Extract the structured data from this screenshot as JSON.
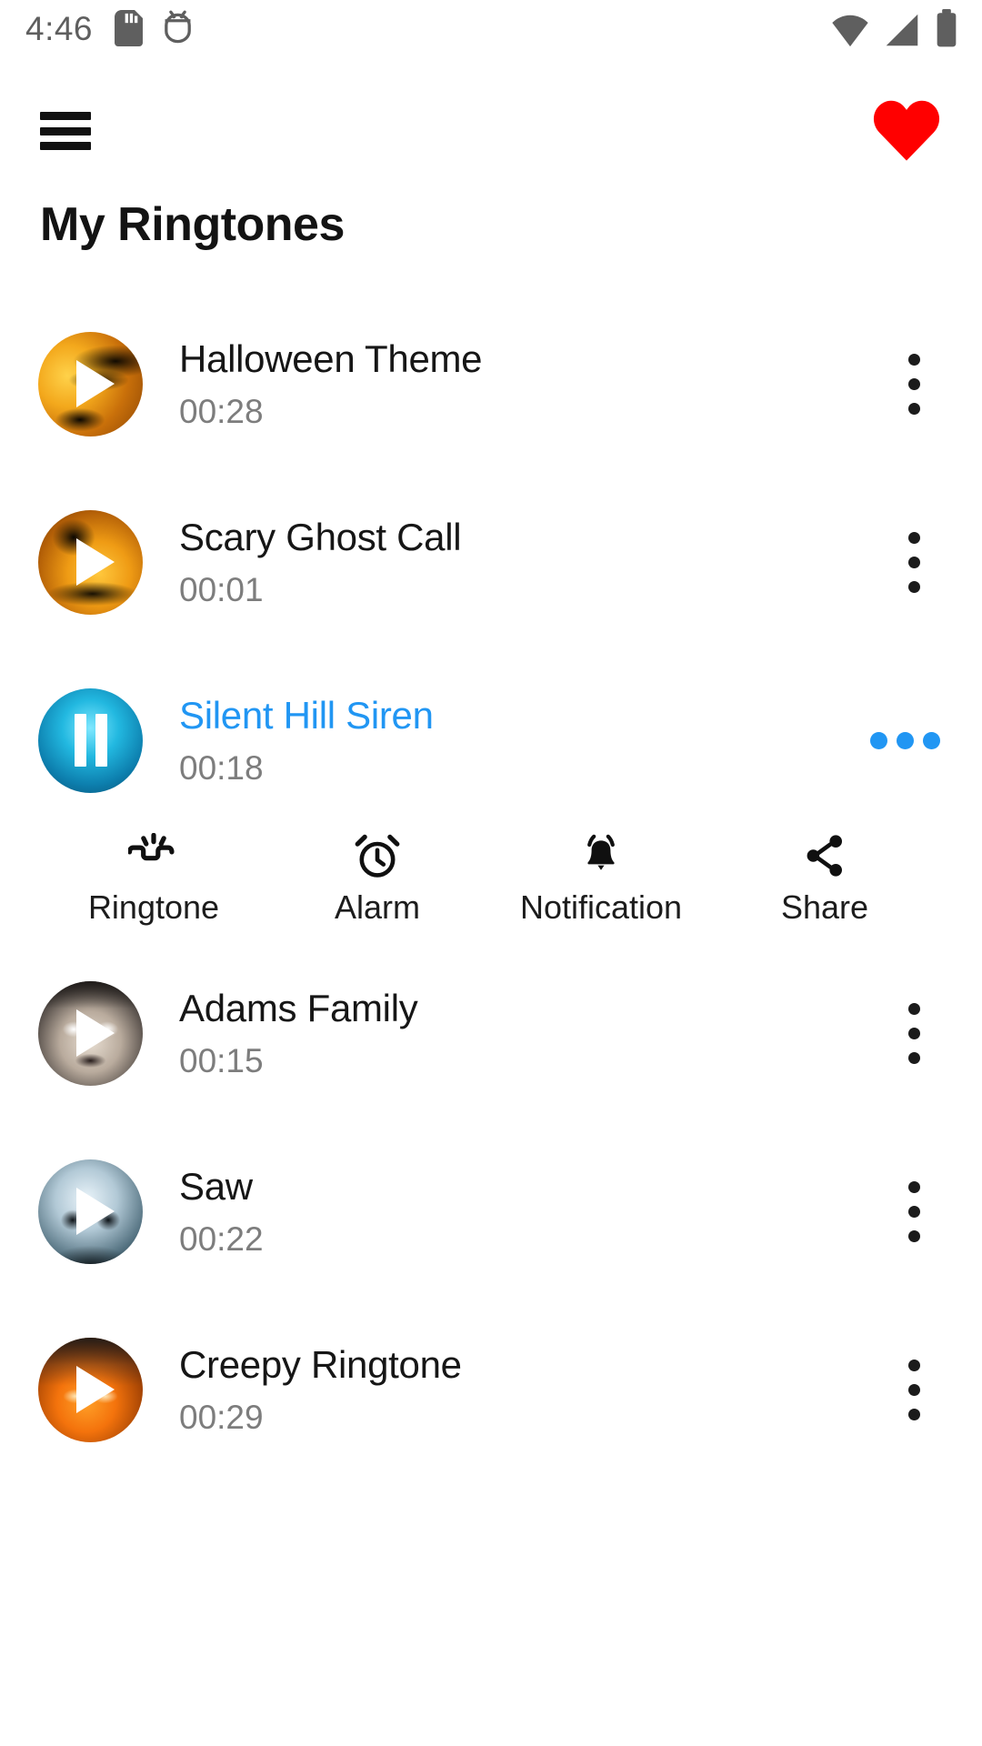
{
  "statusbar": {
    "time": "4:46",
    "icons_left": [
      "sd-card-icon",
      "android-debug-icon"
    ],
    "icons_right": [
      "wifi-icon",
      "cellular-signal-icon",
      "battery-icon"
    ]
  },
  "appbar": {
    "menu_icon": "hamburger-menu-icon",
    "favorite_icon": "heart-icon",
    "favorite_color": "#FF0000"
  },
  "header": {
    "title": "My Ringtones"
  },
  "theme": {
    "accent": "#2196F3",
    "title_color": "#131313",
    "duration_color": "#7d7d7d"
  },
  "list": {
    "items": [
      {
        "title": "Halloween Theme",
        "duration": "00:28",
        "state": "paused",
        "play_icon": "play-icon",
        "menu_icon": "overflow-menu-vertical-icon",
        "art": "art-halloween",
        "selected": false
      },
      {
        "title": "Scary Ghost Call",
        "duration": "00:01",
        "state": "paused",
        "play_icon": "play-icon",
        "menu_icon": "overflow-menu-vertical-icon",
        "art": "art-ghost",
        "selected": false
      },
      {
        "title": "Silent Hill Siren",
        "duration": "00:18",
        "state": "playing",
        "play_icon": "pause-icon",
        "menu_icon": "overflow-menu-horizontal-icon",
        "art": "art-siren",
        "selected": true
      },
      {
        "title": "Adams Family",
        "duration": "00:15",
        "state": "paused",
        "play_icon": "play-icon",
        "menu_icon": "overflow-menu-vertical-icon",
        "art": "art-doll",
        "selected": false
      },
      {
        "title": "Saw",
        "duration": "00:22",
        "state": "paused",
        "play_icon": "play-icon",
        "menu_icon": "overflow-menu-vertical-icon",
        "art": "art-skull2",
        "selected": false
      },
      {
        "title": "Creepy Ringtone",
        "duration": "00:29",
        "state": "paused",
        "play_icon": "play-icon",
        "menu_icon": "overflow-menu-vertical-icon",
        "art": "art-pumpkin",
        "selected": false
      }
    ]
  },
  "actions": [
    {
      "label": "Ringtone",
      "icon": "ringing-phone-icon"
    },
    {
      "label": "Alarm",
      "icon": "alarm-clock-icon"
    },
    {
      "label": "Notification",
      "icon": "bell-icon"
    },
    {
      "label": "Share",
      "icon": "share-nodes-icon"
    }
  ]
}
